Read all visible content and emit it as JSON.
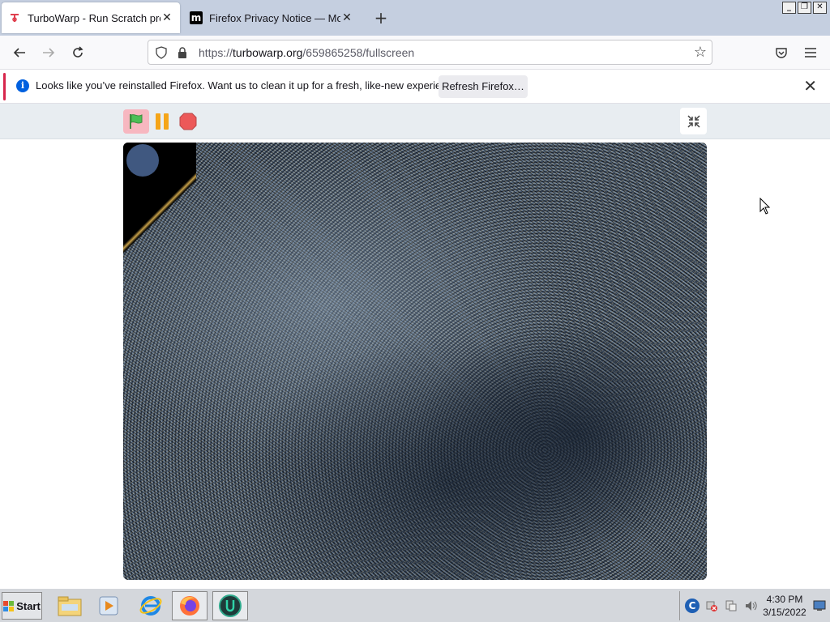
{
  "tabs": [
    {
      "title": "TurboWarp - Run Scratch projects",
      "favicon": "turbowarp-icon",
      "active": true
    },
    {
      "title": "Firefox Privacy Notice — Mozilla",
      "favicon": "mozilla-icon",
      "active": false
    }
  ],
  "tab_close_glyph": "✕",
  "new_tab_glyph": "+",
  "window_buttons": {
    "minimize": "_",
    "maximize": "❐",
    "close": "✕"
  },
  "nav": {
    "url_prefix": "https://",
    "url_host": "turbowarp.org",
    "url_path": "/659865258/fullscreen"
  },
  "notification": {
    "message": "Looks like you’ve reinstalled Firefox. Want us to clean it up for a fresh, like-new experience?",
    "button_label": "Refresh Firefox…",
    "info_glyph": "i",
    "close_glyph": "✕"
  },
  "player": {
    "fullscreen_glyph": "⤡"
  },
  "taskbar": {
    "start_label": "Start",
    "clock_time": "4:30 PM",
    "clock_date": "3/15/2022"
  },
  "colors": {
    "accent_red": "#d7264c",
    "info_blue": "#0060df",
    "flag_green": "#4cbf56",
    "pause_orange": "#f5a518",
    "stop_red": "#ec5959"
  }
}
